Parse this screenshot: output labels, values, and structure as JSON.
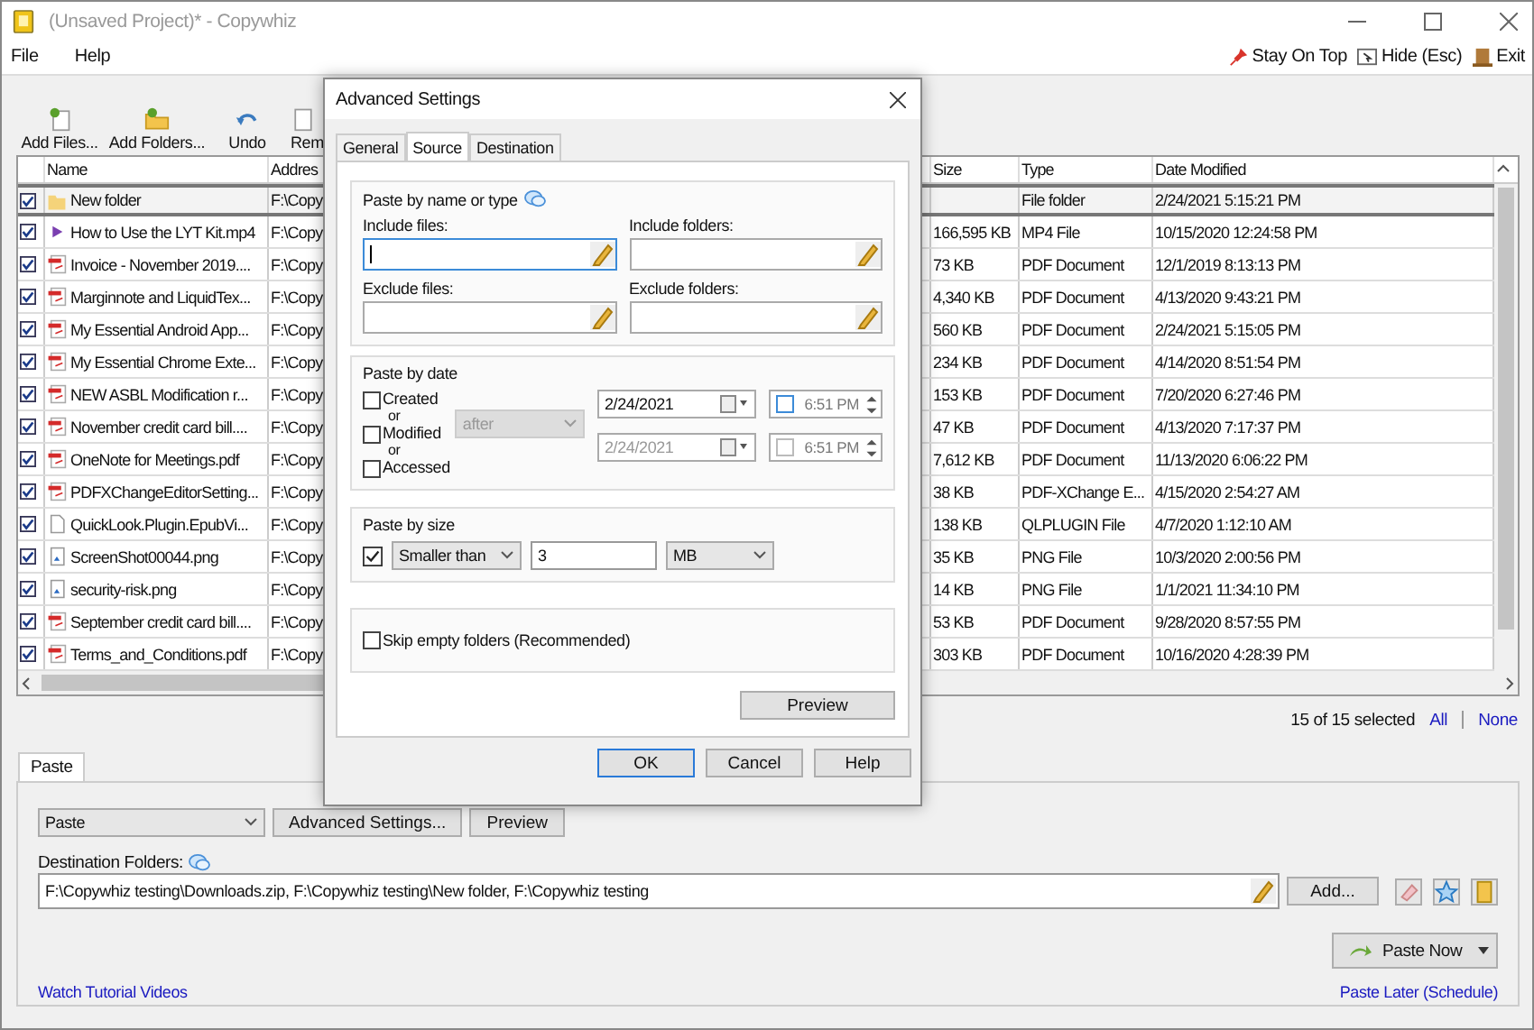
{
  "window": {
    "title": "(Unsaved Project)* - Copywhiz"
  },
  "menu": [
    "File",
    "Help"
  ],
  "menu_actions": [
    {
      "label": "Stay On Top",
      "kind": "pin"
    },
    {
      "label": "Hide (Esc)",
      "kind": "hide"
    },
    {
      "label": "Exit",
      "kind": "exit"
    }
  ],
  "toolbar": [
    {
      "label": "Add Files...",
      "kind": "add-file"
    },
    {
      "label": "Add Folders...",
      "kind": "add-folder"
    },
    {
      "label": "Undo",
      "kind": "undo"
    },
    {
      "label": "Rem",
      "kind": "remove"
    }
  ],
  "table": {
    "columns": [
      "Name",
      "Addres",
      "Size",
      "Type",
      "Date Modified"
    ],
    "rows": [
      {
        "checked": true,
        "selected": true,
        "kind": "folder",
        "name": "New folder",
        "address": "F:\\Copy",
        "type": "File folder",
        "date": "2/24/2021 5:15:21 PM"
      },
      {
        "checked": true,
        "selected": false,
        "kind": "video",
        "name": "How to Use the LYT Kit.mp4",
        "address": "F:\\Copy",
        "size": "166,595 KB",
        "type": "MP4 File",
        "date": "10/15/2020 12:24:58 PM"
      },
      {
        "checked": true,
        "selected": false,
        "kind": "pdf",
        "name": "Invoice - November 2019....",
        "address": "F:\\Copy",
        "size": "73 KB",
        "type": "PDF Document",
        "date": "12/1/2019 8:13:13 PM"
      },
      {
        "checked": true,
        "selected": false,
        "kind": "pdf",
        "name": "Marginnote and LiquidTex...",
        "address": "F:\\Copy",
        "size": "4,340 KB",
        "type": "PDF Document",
        "date": "4/13/2020 9:43:21 PM"
      },
      {
        "checked": true,
        "selected": false,
        "kind": "pdf",
        "name": "My Essential Android App...",
        "address": "F:\\Copy",
        "size": "560 KB",
        "type": "PDF Document",
        "date": "2/24/2021 5:15:05 PM"
      },
      {
        "checked": true,
        "selected": false,
        "kind": "pdf",
        "name": "My Essential Chrome Exte...",
        "address": "F:\\Copy",
        "size": "234 KB",
        "type": "PDF Document",
        "date": "4/14/2020 8:51:54 PM"
      },
      {
        "checked": true,
        "selected": false,
        "kind": "pdf",
        "name": "NEW ASBL Modification r...",
        "address": "F:\\Copy",
        "size": "153 KB",
        "type": "PDF Document",
        "date": "7/20/2020 6:27:46 PM"
      },
      {
        "checked": true,
        "selected": false,
        "kind": "pdf",
        "name": "November credit card bill....",
        "address": "F:\\Copy",
        "size": "47 KB",
        "type": "PDF Document",
        "date": "4/13/2020 7:17:37 PM"
      },
      {
        "checked": true,
        "selected": false,
        "kind": "pdf",
        "name": "OneNote for Meetings.pdf",
        "address": "F:\\Copy",
        "size": "7,612 KB",
        "type": "PDF Document",
        "date": "11/13/2020 6:06:22 PM"
      },
      {
        "checked": true,
        "selected": false,
        "kind": "pdf",
        "name": "PDFXChangeEditorSetting...",
        "address": "F:\\Copy",
        "size": "38 KB",
        "type": "PDF-XChange E...",
        "date": "4/15/2020 2:54:27 AM"
      },
      {
        "checked": true,
        "selected": false,
        "kind": "file",
        "name": "QuickLook.Plugin.EpubVi...",
        "address": "F:\\Copy",
        "size": "138 KB",
        "type": "QLPLUGIN File",
        "date": "4/7/2020 1:12:10 AM"
      },
      {
        "checked": true,
        "selected": false,
        "kind": "image",
        "name": "ScreenShot00044.png",
        "address": "F:\\Copy",
        "size": "35 KB",
        "type": "PNG File",
        "date": "10/3/2020 2:00:56 PM"
      },
      {
        "checked": true,
        "selected": false,
        "kind": "image",
        "name": "security-risk.png",
        "address": "F:\\Copy",
        "size": "14 KB",
        "type": "PNG File",
        "date": "1/1/2021 11:34:10 PM"
      },
      {
        "checked": true,
        "selected": false,
        "kind": "pdf",
        "name": "September credit card bill....",
        "address": "F:\\Copy",
        "size": "53 KB",
        "type": "PDF Document",
        "date": "9/28/2020 8:57:55 PM"
      },
      {
        "checked": true,
        "selected": false,
        "kind": "pdf",
        "name": "Terms_and_Conditions.pdf",
        "address": "F:\\Copy",
        "size": "303 KB",
        "type": "PDF Document",
        "date": "10/16/2020 4:28:39 PM"
      }
    ]
  },
  "selection": {
    "count": "15 of 15 selected",
    "all": "All",
    "none": "None"
  },
  "paste_panel": {
    "tab": "Paste",
    "mode": "Paste",
    "buttons": [
      "Advanced Settings...",
      "Preview"
    ],
    "destination_label": "Destination Folders:",
    "destination_value": "F:\\Copywhiz testing\\Downloads.zip, F:\\Copywhiz testing\\New folder, F:\\Copywhiz testing",
    "add_button": "Add...",
    "paste_now": "Paste Now",
    "tutorial_link": "Watch Tutorial Videos",
    "schedule_link": "Paste Later (Schedule)"
  },
  "dialog": {
    "title": "Advanced Settings",
    "tabs": [
      {
        "label": "General",
        "selected": false
      },
      {
        "label": "Source",
        "selected": true
      },
      {
        "label": "Destination",
        "selected": false
      }
    ],
    "name_group": {
      "title": "Paste by name or type",
      "fields": [
        {
          "label": "Include files:",
          "focused": true
        },
        {
          "label": "Include folders:",
          "focused": false
        },
        {
          "label": "Exclude files:",
          "focused": false
        },
        {
          "label": "Exclude folders:",
          "focused": false
        }
      ]
    },
    "date_group": {
      "title": "Paste by date",
      "checks": [
        {
          "label": "Created",
          "checked": false
        },
        {
          "label": "Modified",
          "checked": false
        },
        {
          "label": "Accessed",
          "checked": false
        }
      ],
      "separators": [
        "or",
        "or"
      ],
      "condition": {
        "value": "after",
        "disabled": true
      },
      "rows": [
        {
          "date": "2/24/2021",
          "time": "6:51 PM",
          "checked": false,
          "disabled": false
        },
        {
          "date": "2/24/2021",
          "time": "6:51 PM",
          "checked": false,
          "disabled": true
        }
      ]
    },
    "size_group": {
      "title": "Paste by size",
      "checked": true,
      "comparison": "Smaller than",
      "value": "3",
      "unit": "MB"
    },
    "skip_empty": {
      "label": "Skip empty folders (Recommended)",
      "checked": false
    },
    "preview": "Preview",
    "buttons": [
      {
        "label": "OK",
        "default": true
      },
      {
        "label": "Cancel",
        "default": false
      },
      {
        "label": "Help",
        "default": false
      }
    ]
  }
}
